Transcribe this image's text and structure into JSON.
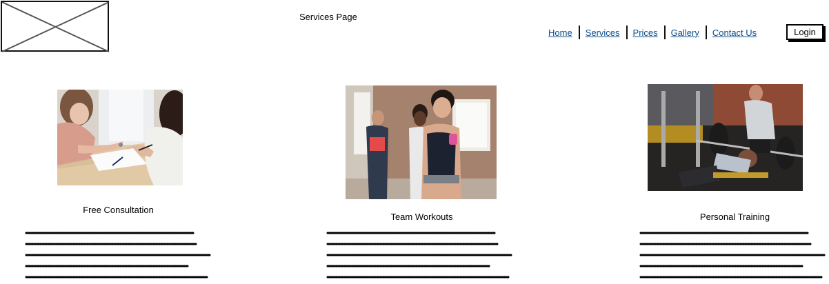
{
  "header": {
    "page_title": "Services Page",
    "logo_icon": "image-placeholder-icon"
  },
  "nav": {
    "items": [
      {
        "label": "Home"
      },
      {
        "label": "Services"
      },
      {
        "label": "Prices"
      },
      {
        "label": "Gallery"
      },
      {
        "label": "Contact Us"
      }
    ],
    "link_color": "#0b4d8c"
  },
  "login": {
    "label": "Login"
  },
  "services": [
    {
      "title": "Free Consultation",
      "image_icon": "consultation-photo"
    },
    {
      "title": "Team Workouts",
      "image_icon": "team-workout-photo"
    },
    {
      "title": "Personal Training",
      "image_icon": "personal-training-photo"
    }
  ]
}
